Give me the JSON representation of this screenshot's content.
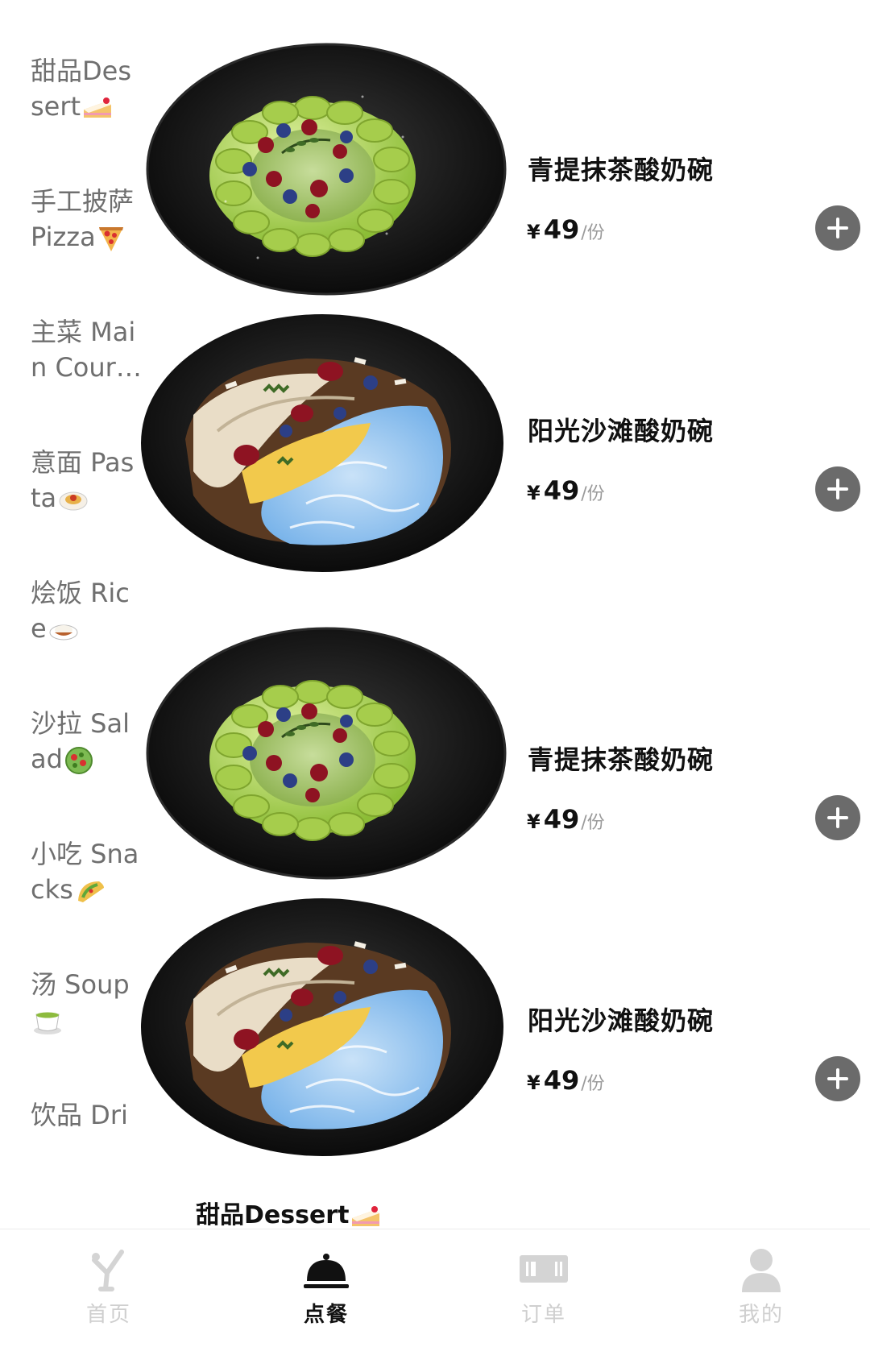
{
  "sidebar": {
    "categories": [
      {
        "label": "甜品Dessert",
        "icon": "cake-icon"
      },
      {
        "label": "手工披萨Pizza",
        "icon": "pizza-icon"
      },
      {
        "label": "主菜 Main Cour…",
        "icon": ""
      },
      {
        "label": "意面 Pasta",
        "icon": "pasta-icon"
      },
      {
        "label": "烩饭 Rice",
        "icon": "rice-icon"
      },
      {
        "label": "沙拉 Salad",
        "icon": "salad-icon"
      },
      {
        "label": "小吃 Snacks",
        "icon": "taco-icon"
      },
      {
        "label": "汤 Soup",
        "icon": "tea-icon"
      },
      {
        "label": "饮品 Dri",
        "icon": ""
      }
    ]
  },
  "items": [
    {
      "name": "青提抹茶酸奶碗",
      "currency": "¥",
      "price": "49",
      "unit": "/份",
      "variant": "green"
    },
    {
      "name": "阳光沙滩酸奶碗",
      "currency": "¥",
      "price": "49",
      "unit": "/份",
      "variant": "blue"
    },
    {
      "name": "青提抹茶酸奶碗",
      "currency": "¥",
      "price": "49",
      "unit": "/份",
      "variant": "green"
    },
    {
      "name": "阳光沙滩酸奶碗",
      "currency": "¥",
      "price": "49",
      "unit": "/份",
      "variant": "blue"
    }
  ],
  "section_header": {
    "label": "甜品Dessert",
    "icon": "cake-icon"
  },
  "tabbar": {
    "tabs": [
      {
        "label": "首页",
        "icon": "chef-icon",
        "active": false
      },
      {
        "label": "点餐",
        "icon": "cloche-icon",
        "active": true
      },
      {
        "label": "订单",
        "icon": "ticket-icon",
        "active": false
      },
      {
        "label": "我的",
        "icon": "user-icon",
        "active": false
      }
    ]
  },
  "colors": {
    "active": "#111111",
    "inactive": "#cfcfcf",
    "add_button": "#6b6b6b"
  }
}
